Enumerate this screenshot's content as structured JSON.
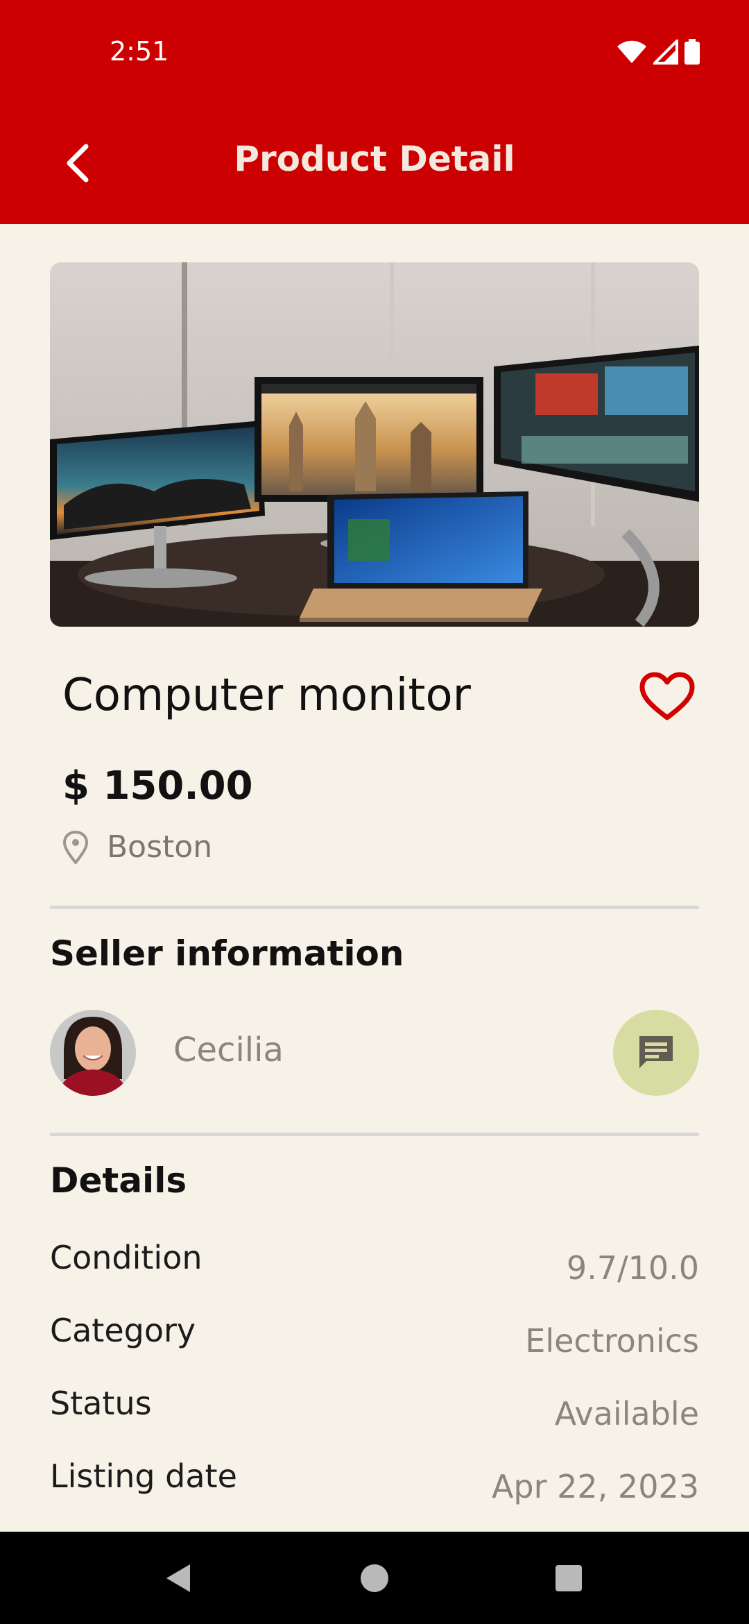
{
  "status_bar": {
    "time": "2:51"
  },
  "header": {
    "title": "Product Detail",
    "back_icon": "chevron-left-icon"
  },
  "product": {
    "name": "Computer monitor",
    "price": "$ 150.00",
    "location": "Boston",
    "favorite_icon": "heart-outline-icon",
    "image": "product-photo"
  },
  "seller": {
    "section_title": "Seller information",
    "name": "Cecilia",
    "avatar": "seller-avatar",
    "chat_icon": "chat-bubble-icon"
  },
  "details": {
    "section_title": "Details",
    "rows": [
      {
        "label": "Condition",
        "value": "9.7/10.0"
      },
      {
        "label": "Category",
        "value": "Electronics"
      },
      {
        "label": "Status",
        "value": "Available"
      },
      {
        "label": "Listing date",
        "value": "Apr 22, 2023"
      }
    ]
  },
  "colors": {
    "header_bg": "#cc0000",
    "page_bg": "#f7f2e8",
    "chat_button_bg": "#d7dda2",
    "favorite_red": "#d20000"
  }
}
